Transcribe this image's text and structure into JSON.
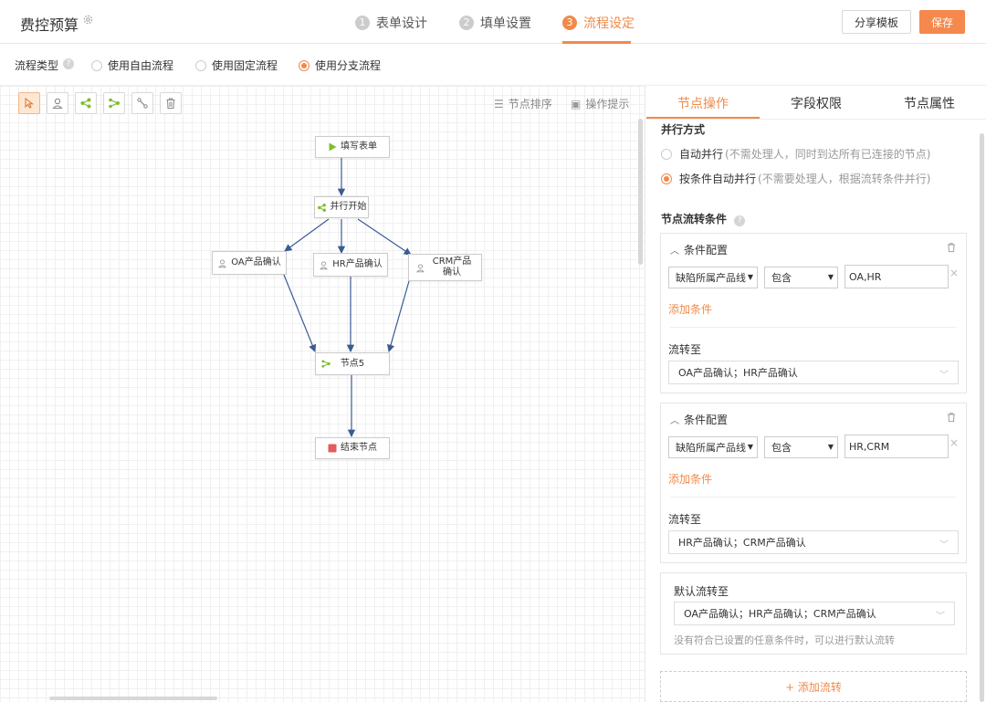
{
  "header": {
    "title": "费控预算",
    "steps": [
      {
        "num": "1",
        "label": "表单设计"
      },
      {
        "num": "2",
        "label": "填单设置"
      },
      {
        "num": "3",
        "label": "流程设定"
      }
    ],
    "share_label": "分享模板",
    "save_label": "保存"
  },
  "flow_type": {
    "label": "流程类型",
    "options": [
      "使用自由流程",
      "使用固定流程",
      "使用分支流程"
    ],
    "selected": "使用分支流程"
  },
  "canvas": {
    "links": {
      "sort": "节点排序",
      "hint": "操作提示"
    },
    "nodes": {
      "start": "填写表单",
      "parallel": "并行开始",
      "oa": "OA产品确认",
      "hr": "HR产品确认",
      "crm": "CRM产品确认",
      "merge": "节点5",
      "end": "结束节点"
    }
  },
  "panel": {
    "tabs": [
      "节点操作",
      "字段权限",
      "节点属性"
    ],
    "parallel_title": "并行方式",
    "parallel_options": [
      {
        "label": "自动并行",
        "hint": "(不需处理人，同时到达所有已连接的节点)"
      },
      {
        "label": "按条件自动并行",
        "hint": "(不需要处理人，根据流转条件并行)"
      }
    ],
    "condition_title": "节点流转条件",
    "conditions": [
      {
        "title": "条件配置",
        "field": "缺陷所属产品线",
        "op": "包含",
        "value": "OA,HR",
        "add": "添加条件",
        "flow_label": "流转至",
        "flow_to": "OA产品确认；HR产品确认"
      },
      {
        "title": "条件配置",
        "field": "缺陷所属产品线",
        "op": "包含",
        "value": "HR,CRM",
        "add": "添加条件",
        "flow_label": "流转至",
        "flow_to": "HR产品确认；CRM产品确认"
      }
    ],
    "default": {
      "label": "默认流转至",
      "value": "OA产品确认；HR产品确认；CRM产品确认",
      "note": "没有符合已设置的任意条件时，可以进行默认流转"
    },
    "add_flow": "+ 添加流转"
  },
  "colors": {
    "accent": "#f08a4b",
    "green": "#7cbf2e",
    "end_red": "#e35b5b",
    "edge": "#3a5b94"
  }
}
